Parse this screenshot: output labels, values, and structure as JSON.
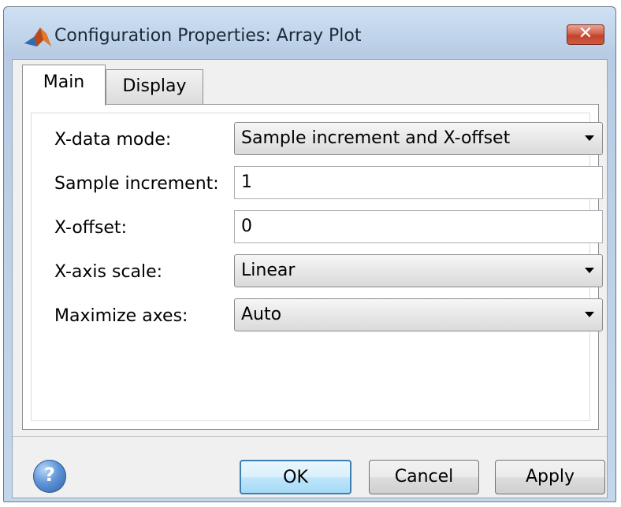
{
  "window": {
    "title": "Configuration Properties: Array Plot",
    "close_label": "✕"
  },
  "tabs": [
    {
      "label": "Main",
      "active": true
    },
    {
      "label": "Display",
      "active": false
    }
  ],
  "fields": {
    "xdata_mode": {
      "label": "X-data mode:",
      "value": "Sample increment and X-offset"
    },
    "sample_increment": {
      "label": "Sample increment:",
      "value": "1"
    },
    "x_offset": {
      "label": "X-offset:",
      "value": "0"
    },
    "xaxis_scale": {
      "label": "X-axis scale:",
      "value": "Linear"
    },
    "maximize_axes": {
      "label": "Maximize axes:",
      "value": "Auto"
    }
  },
  "buttons": {
    "help": "?",
    "ok": "OK",
    "cancel": "Cancel",
    "apply": "Apply"
  },
  "colors": {
    "titlebar": "#bfd3ea",
    "close": "#c2432b",
    "ok_border": "#3c7fb1"
  }
}
